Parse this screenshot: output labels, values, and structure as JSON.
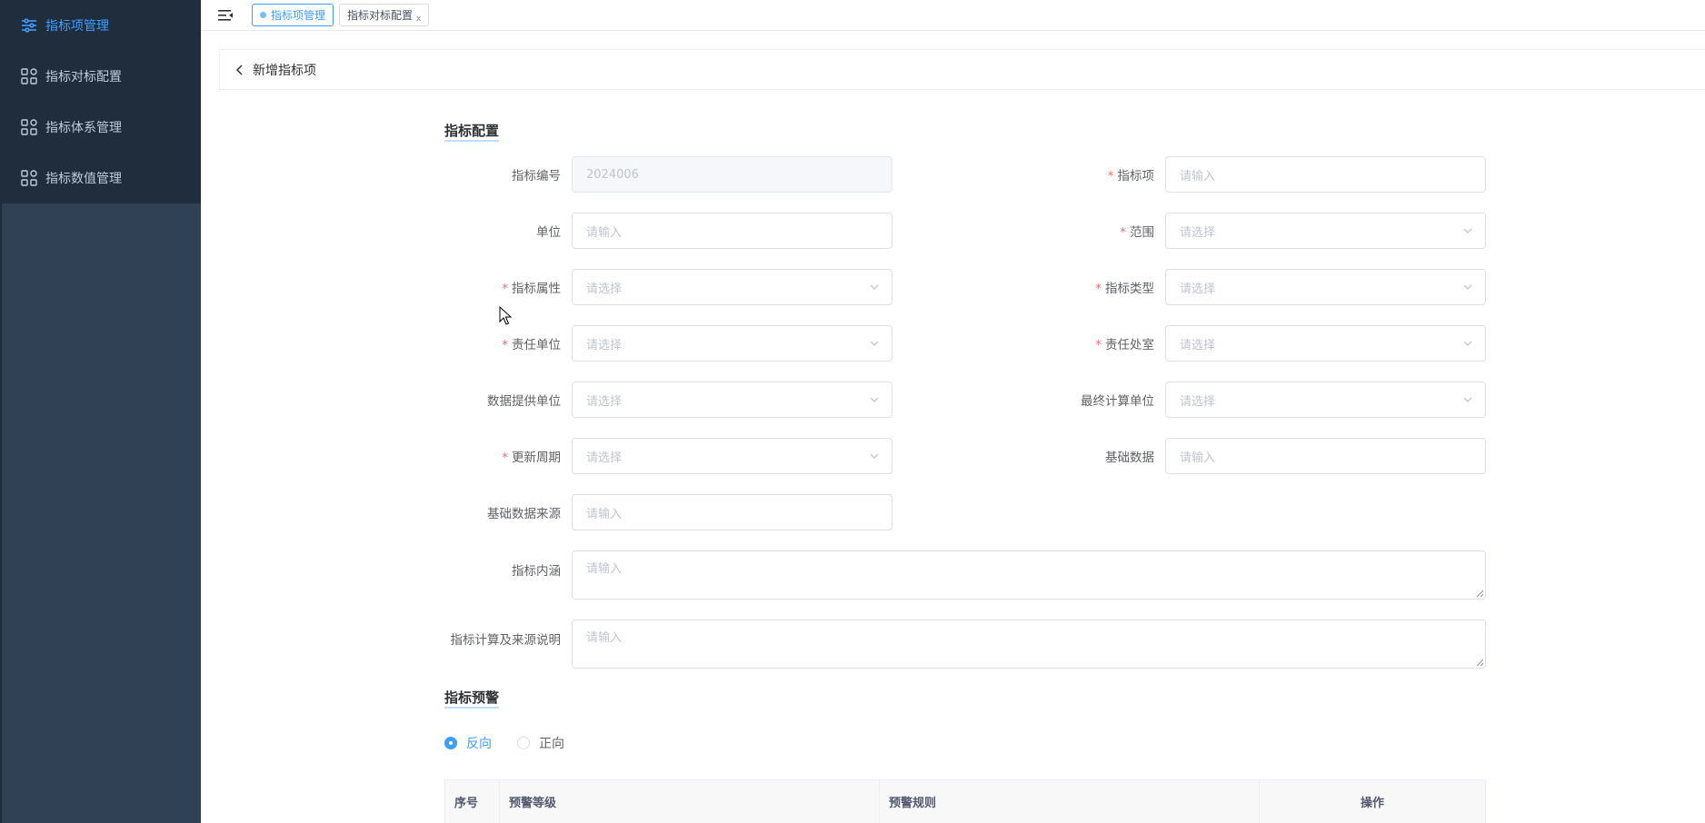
{
  "sidebar": {
    "items": [
      {
        "label": "指标项管理",
        "icon": "sliders-icon",
        "active": true
      },
      {
        "label": "指标对标配置",
        "icon": "grid-icon",
        "active": false
      },
      {
        "label": "指标体系管理",
        "icon": "grid-icon",
        "active": false
      },
      {
        "label": "指标数值管理",
        "icon": "grid-icon",
        "active": false
      }
    ]
  },
  "topbar": {
    "tags": [
      {
        "label": "指标项管理",
        "active": true
      },
      {
        "label": "指标对标配置",
        "active": false,
        "close": "x"
      }
    ]
  },
  "header": {
    "title": "新增指标项"
  },
  "sections": {
    "config": "指标配置",
    "warning": "指标预警"
  },
  "form": {
    "code": {
      "label": "指标编号",
      "value": "2024006"
    },
    "item": {
      "label": "指标项",
      "placeholder": "请输入"
    },
    "unit": {
      "label": "单位",
      "placeholder": "请输入"
    },
    "range": {
      "label": "范围",
      "placeholder": "请选择"
    },
    "attr": {
      "label": "指标属性",
      "placeholder": "请选择"
    },
    "type": {
      "label": "指标类型",
      "placeholder": "请选择"
    },
    "resp_unit": {
      "label": "责任单位",
      "placeholder": "请选择"
    },
    "resp_office": {
      "label": "责任处室",
      "placeholder": "请选择"
    },
    "data_provider": {
      "label": "数据提供单位",
      "placeholder": "请选择"
    },
    "final_unit": {
      "label": "最终计算单位",
      "placeholder": "请选择"
    },
    "period": {
      "label": "更新周期",
      "placeholder": "请选择"
    },
    "base_data": {
      "label": "基础数据",
      "placeholder": "请输入"
    },
    "base_source": {
      "label": "基础数据来源",
      "placeholder": "请输入"
    },
    "connotation": {
      "label": "指标内涵",
      "placeholder": "请输入"
    },
    "calc_desc": {
      "label": "指标计算及来源说明",
      "placeholder": "请输入"
    }
  },
  "required_mark": "*",
  "warning": {
    "radios": [
      {
        "label": "反向",
        "checked": true
      },
      {
        "label": "正向",
        "checked": false
      }
    ],
    "table_headers": [
      "序号",
      "预警等级",
      "预警规则",
      "操作"
    ]
  },
  "colors": {
    "accent": "#409eff",
    "sidebar_bg": "#304156",
    "required": "#f56c6c"
  }
}
